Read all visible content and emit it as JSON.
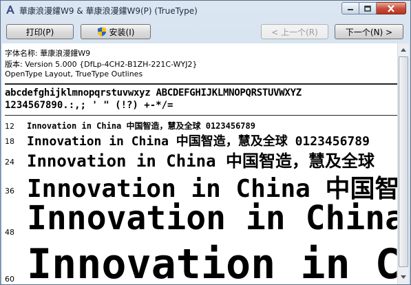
{
  "window": {
    "title": "華康浪漫鑵W9 & 華康浪漫鑵W9(P)  (TrueType)"
  },
  "toolbar": {
    "print_label": "打印(P)",
    "install_label": "安装(I)",
    "prev_label": "< 上一个(R)",
    "next_label": "下一个(N) >"
  },
  "font_info": {
    "name_line": "字体名称: 華康浪漫鑵W9",
    "version_line": "版本: Version 5.000 {DfLp-4CH2-B1ZH-221C-WYJ2}",
    "format_line": "OpenType Layout, TrueType Outlines"
  },
  "charset": {
    "line1": "abcdefghijklmnopqrstuvwxyz ABCDEFGHIJKLMNOPQRSTUVWXYZ",
    "line2": "1234567890.:,; ' \" (!?) +-*/="
  },
  "samples": [
    {
      "size": "12",
      "text": "Innovation in China 中国智造，慧及全球 0123456789"
    },
    {
      "size": "18",
      "text": "Innovation in China 中国智造，慧及全球 0123456789"
    },
    {
      "size": "24",
      "text": "Innovation in China 中国智造，慧及全球"
    },
    {
      "size": "36",
      "text": "Innovation in China 中国智造"
    },
    {
      "size": "48",
      "text": "Innovation in China"
    },
    {
      "size": "60",
      "text": "Innovation in China"
    }
  ],
  "icons": {
    "app": "font-file-icon",
    "shield": "uac-shield-icon",
    "minimize": "minimize-icon",
    "maximize": "maximize-icon",
    "close": "close-icon",
    "scroll_up": "arrow-up-icon",
    "scroll_down": "arrow-down-icon"
  },
  "colors": {
    "titlebar": "#cfdbe8",
    "close_button": "#c94a36"
  }
}
